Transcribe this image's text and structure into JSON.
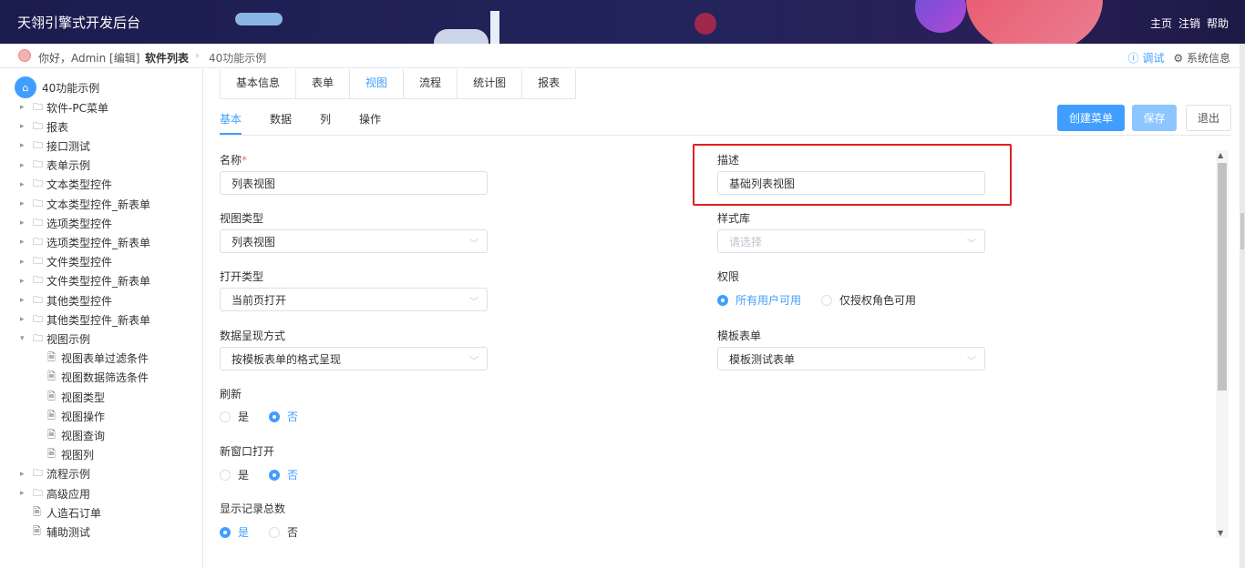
{
  "header": {
    "title": "天翎引擎式开发后台",
    "nav": [
      "主页",
      "注销",
      "帮助"
    ]
  },
  "breadcrumb": {
    "greeting": "你好，Admin [编辑]",
    "current": "软件列表",
    "separator": "›",
    "leaf": "40功能示例",
    "debug": "ⓘ 调试",
    "system": "⚙ 系统信息"
  },
  "sidebar": {
    "root": "40功能示例",
    "items": [
      {
        "label": "软件-PC菜单",
        "type": "folder",
        "expanded": false,
        "level": 1
      },
      {
        "label": "报表",
        "type": "folder",
        "expanded": false,
        "level": 1
      },
      {
        "label": "接口测试",
        "type": "folder",
        "expanded": false,
        "level": 1
      },
      {
        "label": "表单示例",
        "type": "folder",
        "expanded": false,
        "level": 1
      },
      {
        "label": "文本类型控件",
        "type": "folder",
        "expanded": false,
        "level": 1
      },
      {
        "label": "文本类型控件_新表单",
        "type": "folder",
        "expanded": false,
        "level": 1
      },
      {
        "label": "选项类型控件",
        "type": "folder",
        "expanded": false,
        "level": 1
      },
      {
        "label": "选项类型控件_新表单",
        "type": "folder",
        "expanded": false,
        "level": 1
      },
      {
        "label": "文件类型控件",
        "type": "folder",
        "expanded": false,
        "level": 1
      },
      {
        "label": "文件类型控件_新表单",
        "type": "folder",
        "expanded": false,
        "level": 1
      },
      {
        "label": "其他类型控件",
        "type": "folder",
        "expanded": false,
        "level": 1
      },
      {
        "label": "其他类型控件_新表单",
        "type": "folder",
        "expanded": false,
        "level": 1
      },
      {
        "label": "视图示例",
        "type": "folder",
        "expanded": true,
        "level": 1
      },
      {
        "label": "视图表单过滤条件",
        "type": "file",
        "level": 2
      },
      {
        "label": "视图数据筛选条件",
        "type": "file",
        "level": 2
      },
      {
        "label": "视图类型",
        "type": "file",
        "level": 2
      },
      {
        "label": "视图操作",
        "type": "file",
        "level": 2
      },
      {
        "label": "视图查询",
        "type": "file",
        "level": 2
      },
      {
        "label": "视图列",
        "type": "file",
        "level": 2
      },
      {
        "label": "流程示例",
        "type": "folder",
        "expanded": false,
        "level": 1
      },
      {
        "label": "高级应用",
        "type": "folder",
        "expanded": false,
        "level": 1
      },
      {
        "label": "人造石订单",
        "type": "file",
        "level": 1
      },
      {
        "label": "辅助测试",
        "type": "file",
        "level": 1
      }
    ]
  },
  "top_tabs": [
    "基本信息",
    "表单",
    "视图",
    "流程",
    "统计图",
    "报表"
  ],
  "top_tab_active": 2,
  "sub_tabs": [
    "基本",
    "数据",
    "列",
    "操作"
  ],
  "sub_tab_active": 0,
  "buttons": {
    "create_menu": "创建菜单",
    "save": "保存",
    "exit": "退出"
  },
  "form": {
    "name": {
      "label": "名称",
      "required": "*",
      "value": "列表视图"
    },
    "description": {
      "label": "描述",
      "value": "基础列表视图"
    },
    "view_type": {
      "label": "视图类型",
      "value": "列表视图"
    },
    "style_lib": {
      "label": "样式库",
      "placeholder": "请选择"
    },
    "open_type": {
      "label": "打开类型",
      "value": "当前页打开"
    },
    "permission": {
      "label": "权限",
      "options": [
        "所有用户可用",
        "仅授权角色可用"
      ],
      "selected": 0
    },
    "data_display": {
      "label": "数据呈现方式",
      "value": "按模板表单的格式呈现"
    },
    "template_form": {
      "label": "模板表单",
      "value": "模板测试表单"
    },
    "refresh": {
      "label": "刷新",
      "options": [
        "是",
        "否"
      ],
      "selected": 1
    },
    "new_window": {
      "label": "新窗口打开",
      "options": [
        "是",
        "否"
      ],
      "selected": 1
    },
    "show_total": {
      "label": "显示记录总数",
      "options": [
        "是",
        "否"
      ],
      "selected": 0
    }
  },
  "colors": {
    "primary": "#409eff",
    "highlight": "#e02020",
    "header_bg": "#1b1c4e"
  },
  "icons": {
    "home": "home-icon",
    "folder": "folder-icon",
    "file": "file-icon",
    "chevron": "chevron-down-icon"
  }
}
